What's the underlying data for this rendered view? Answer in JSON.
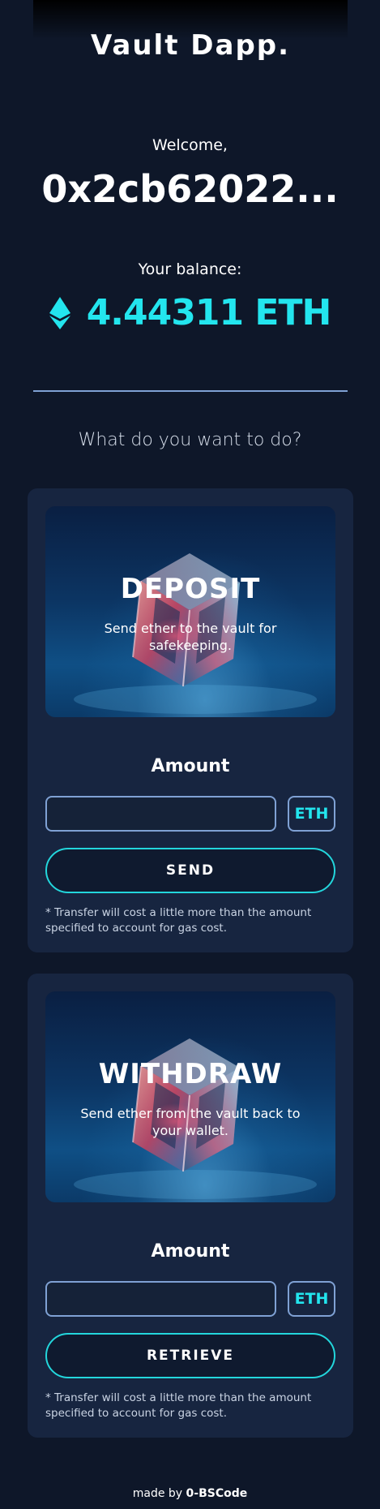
{
  "header": {
    "app_title": "Vault Dapp."
  },
  "account": {
    "welcome_text": "Welcome,",
    "address": "0x2cb62022...",
    "balance_label": "Your balance:",
    "balance_amount": "4.44311 ETH",
    "balance_icon": "ethereum-icon"
  },
  "prompt": "What do you want to do?",
  "deposit": {
    "title": "DEPOSIT",
    "subtitle": "Send ether to the vault for safekeeping.",
    "amount_label": "Amount",
    "amount_value": "",
    "amount_placeholder": "",
    "unit": "ETH",
    "button_label": "SEND",
    "note": "* Transfer will cost a little more than the amount specified to account for gas cost."
  },
  "withdraw": {
    "title": "WITHDRAW",
    "subtitle": "Send ether from the vault back to your wallet.",
    "amount_label": "Amount",
    "amount_value": "",
    "amount_placeholder": "",
    "unit": "ETH",
    "button_label": "RETRIEVE",
    "note": "* Transfer will cost a little more than the amount specified to account for gas cost."
  },
  "footer": {
    "prefix": "made by",
    "author": "0-BSCode"
  },
  "colors": {
    "background": "#0e1729",
    "card": "#172540",
    "accent": "#23e5ee",
    "border": "#7fa1d4"
  }
}
